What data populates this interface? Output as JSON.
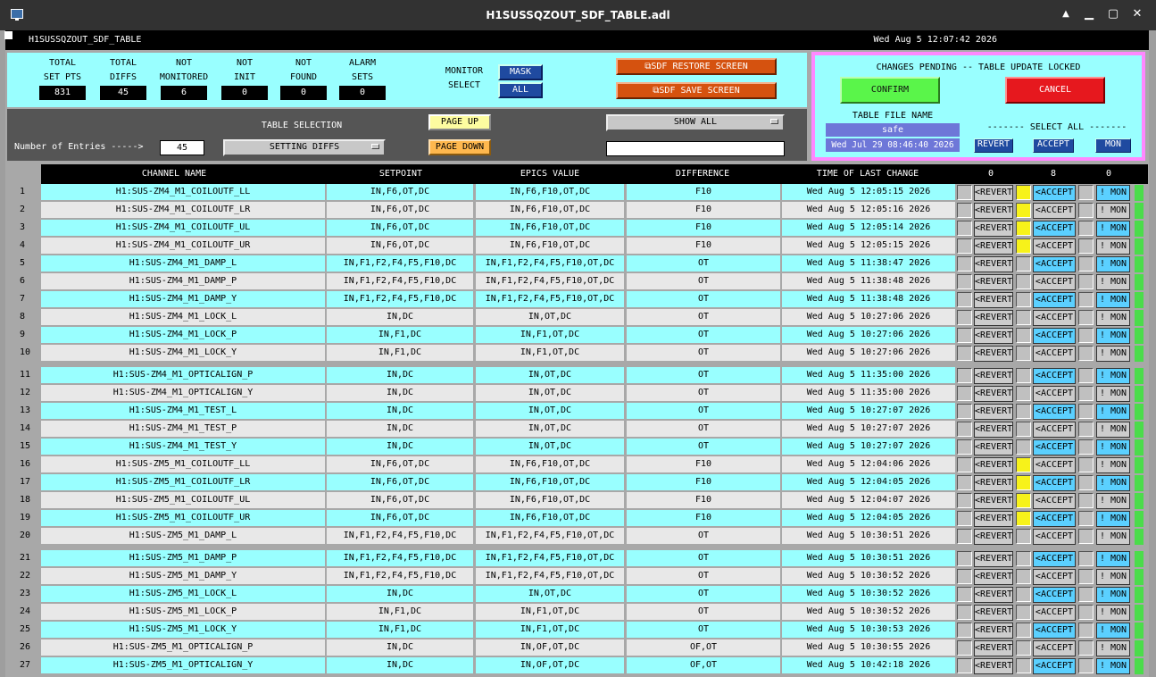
{
  "window": {
    "title": "H1SUSSQZOUT_SDF_TABLE.adl",
    "min": "▁",
    "max": "▢",
    "close": "✕",
    "restore": "▲"
  },
  "header": {
    "name": "H1SUSSQZOUT_SDF_TABLE",
    "datetime": "Wed Aug  5 12:07:42 2026"
  },
  "stats": [
    {
      "label1": "TOTAL",
      "label2": "SET PTS",
      "value": "831"
    },
    {
      "label1": "TOTAL",
      "label2": "DIFFS",
      "value": "45"
    },
    {
      "label1": "NOT",
      "label2": "MONITORED",
      "value": "6"
    },
    {
      "label1": "NOT",
      "label2": "INIT",
      "value": "0"
    },
    {
      "label1": "NOT",
      "label2": "FOUND",
      "value": "0"
    },
    {
      "label1": "ALARM",
      "label2": "SETS",
      "value": "0"
    }
  ],
  "monitor": {
    "label1": "MONITOR",
    "label2": "SELECT",
    "mask": "MASK",
    "all": "ALL"
  },
  "restore_btn": "SDF RESTORE SCREEN",
  "save_btn": "SDF SAVE SCREEN",
  "pending": {
    "title": "CHANGES PENDING -- TABLE UPDATE LOCKED",
    "confirm": "CONFIRM",
    "cancel": "CANCEL",
    "file_label": "TABLE FILE NAME",
    "file": "safe",
    "file_time": "Wed Jul 29 08:46:40 2026",
    "select_all": "------- SELECT ALL -------",
    "revert": "REVERT",
    "accept": "ACCEPT",
    "mon": "MON"
  },
  "table_sel": {
    "label": "TABLE SELECTION",
    "entries_label": "Number of Entries ----->",
    "entries": "45",
    "mode": "SETTING DIFFS",
    "page_up": "PAGE UP",
    "page_down": "PAGE DOWN",
    "show": "SHOW ALL",
    "filter": ""
  },
  "columns": {
    "name": "CHANNEL NAME",
    "setpoint": "SETPOINT",
    "epics": "EPICS VALUE",
    "diff": "DIFFERENCE",
    "time": "TIME OF LAST CHANGE",
    "c1": "0",
    "c2": "8",
    "c3": "0"
  },
  "buttons": {
    "revert": "<REVERT",
    "accept": "<ACCEPT",
    "mon": "! MON"
  },
  "rows": [
    {
      "n": "1",
      "name": "H1:SUS-ZM4_M1_COILOUTF_LL",
      "sp": "IN,F6,OT,DC",
      "ev": "IN,F6,F10,OT,DC",
      "df": "F10",
      "t": "Wed Aug  5 12:05:15 2026",
      "acc": true
    },
    {
      "n": "2",
      "name": "H1:SUS-ZM4_M1_COILOUTF_LR",
      "sp": "IN,F6,OT,DC",
      "ev": "IN,F6,F10,OT,DC",
      "df": "F10",
      "t": "Wed Aug  5 12:05:16 2026",
      "acc": true
    },
    {
      "n": "3",
      "name": "H1:SUS-ZM4_M1_COILOUTF_UL",
      "sp": "IN,F6,OT,DC",
      "ev": "IN,F6,F10,OT,DC",
      "df": "F10",
      "t": "Wed Aug  5 12:05:14 2026",
      "acc": true
    },
    {
      "n": "4",
      "name": "H1:SUS-ZM4_M1_COILOUTF_UR",
      "sp": "IN,F6,OT,DC",
      "ev": "IN,F6,F10,OT,DC",
      "df": "F10",
      "t": "Wed Aug  5 12:05:15 2026",
      "acc": true
    },
    {
      "n": "5",
      "name": "H1:SUS-ZM4_M1_DAMP_L",
      "sp": "IN,F1,F2,F4,F5,F10,DC",
      "ev": "IN,F1,F2,F4,F5,F10,OT,DC",
      "df": "OT",
      "t": "Wed Aug  5 11:38:47 2026",
      "acc": false
    },
    {
      "n": "6",
      "name": "H1:SUS-ZM4_M1_DAMP_P",
      "sp": "IN,F1,F2,F4,F5,F10,DC",
      "ev": "IN,F1,F2,F4,F5,F10,OT,DC",
      "df": "OT",
      "t": "Wed Aug  5 11:38:48 2026",
      "acc": false
    },
    {
      "n": "7",
      "name": "H1:SUS-ZM4_M1_DAMP_Y",
      "sp": "IN,F1,F2,F4,F5,F10,DC",
      "ev": "IN,F1,F2,F4,F5,F10,OT,DC",
      "df": "OT",
      "t": "Wed Aug  5 11:38:48 2026",
      "acc": false
    },
    {
      "n": "8",
      "name": "H1:SUS-ZM4_M1_LOCK_L",
      "sp": "IN,DC",
      "ev": "IN,OT,DC",
      "df": "OT",
      "t": "Wed Aug  5 10:27:06 2026",
      "acc": false
    },
    {
      "n": "9",
      "name": "H1:SUS-ZM4_M1_LOCK_P",
      "sp": "IN,F1,DC",
      "ev": "IN,F1,OT,DC",
      "df": "OT",
      "t": "Wed Aug  5 10:27:06 2026",
      "acc": false
    },
    {
      "n": "10",
      "name": "H1:SUS-ZM4_M1_LOCK_Y",
      "sp": "IN,F1,DC",
      "ev": "IN,F1,OT,DC",
      "df": "OT",
      "t": "Wed Aug  5 10:27:06 2026",
      "acc": false
    },
    {
      "n": "11",
      "name": "H1:SUS-ZM4_M1_OPTICALIGN_P",
      "sp": "IN,DC",
      "ev": "IN,OT,DC",
      "df": "OT",
      "t": "Wed Aug  5 11:35:00 2026",
      "acc": false
    },
    {
      "n": "12",
      "name": "H1:SUS-ZM4_M1_OPTICALIGN_Y",
      "sp": "IN,DC",
      "ev": "IN,OT,DC",
      "df": "OT",
      "t": "Wed Aug  5 11:35:00 2026",
      "acc": false
    },
    {
      "n": "13",
      "name": "H1:SUS-ZM4_M1_TEST_L",
      "sp": "IN,DC",
      "ev": "IN,OT,DC",
      "df": "OT",
      "t": "Wed Aug  5 10:27:07 2026",
      "acc": false
    },
    {
      "n": "14",
      "name": "H1:SUS-ZM4_M1_TEST_P",
      "sp": "IN,DC",
      "ev": "IN,OT,DC",
      "df": "OT",
      "t": "Wed Aug  5 10:27:07 2026",
      "acc": false
    },
    {
      "n": "15",
      "name": "H1:SUS-ZM4_M1_TEST_Y",
      "sp": "IN,DC",
      "ev": "IN,OT,DC",
      "df": "OT",
      "t": "Wed Aug  5 10:27:07 2026",
      "acc": false
    },
    {
      "n": "16",
      "name": "H1:SUS-ZM5_M1_COILOUTF_LL",
      "sp": "IN,F6,OT,DC",
      "ev": "IN,F6,F10,OT,DC",
      "df": "F10",
      "t": "Wed Aug  5 12:04:06 2026",
      "acc": true
    },
    {
      "n": "17",
      "name": "H1:SUS-ZM5_M1_COILOUTF_LR",
      "sp": "IN,F6,OT,DC",
      "ev": "IN,F6,F10,OT,DC",
      "df": "F10",
      "t": "Wed Aug  5 12:04:05 2026",
      "acc": true
    },
    {
      "n": "18",
      "name": "H1:SUS-ZM5_M1_COILOUTF_UL",
      "sp": "IN,F6,OT,DC",
      "ev": "IN,F6,F10,OT,DC",
      "df": "F10",
      "t": "Wed Aug  5 12:04:07 2026",
      "acc": true
    },
    {
      "n": "19",
      "name": "H1:SUS-ZM5_M1_COILOUTF_UR",
      "sp": "IN,F6,OT,DC",
      "ev": "IN,F6,F10,OT,DC",
      "df": "F10",
      "t": "Wed Aug  5 12:04:05 2026",
      "acc": true
    },
    {
      "n": "20",
      "name": "H1:SUS-ZM5_M1_DAMP_L",
      "sp": "IN,F1,F2,F4,F5,F10,DC",
      "ev": "IN,F1,F2,F4,F5,F10,OT,DC",
      "df": "OT",
      "t": "Wed Aug  5 10:30:51 2026",
      "acc": false
    },
    {
      "n": "21",
      "name": "H1:SUS-ZM5_M1_DAMP_P",
      "sp": "IN,F1,F2,F4,F5,F10,DC",
      "ev": "IN,F1,F2,F4,F5,F10,OT,DC",
      "df": "OT",
      "t": "Wed Aug  5 10:30:51 2026",
      "acc": false
    },
    {
      "n": "22",
      "name": "H1:SUS-ZM5_M1_DAMP_Y",
      "sp": "IN,F1,F2,F4,F5,F10,DC",
      "ev": "IN,F1,F2,F4,F5,F10,OT,DC",
      "df": "OT",
      "t": "Wed Aug  5 10:30:52 2026",
      "acc": false
    },
    {
      "n": "23",
      "name": "H1:SUS-ZM5_M1_LOCK_L",
      "sp": "IN,DC",
      "ev": "IN,OT,DC",
      "df": "OT",
      "t": "Wed Aug  5 10:30:52 2026",
      "acc": false
    },
    {
      "n": "24",
      "name": "H1:SUS-ZM5_M1_LOCK_P",
      "sp": "IN,F1,DC",
      "ev": "IN,F1,OT,DC",
      "df": "OT",
      "t": "Wed Aug  5 10:30:52 2026",
      "acc": false
    },
    {
      "n": "25",
      "name": "H1:SUS-ZM5_M1_LOCK_Y",
      "sp": "IN,F1,DC",
      "ev": "IN,F1,OT,DC",
      "df": "OT",
      "t": "Wed Aug  5 10:30:53 2026",
      "acc": false
    },
    {
      "n": "26",
      "name": "H1:SUS-ZM5_M1_OPTICALIGN_P",
      "sp": "IN,DC",
      "ev": "IN,OF,OT,DC",
      "df": "OF,OT",
      "t": "Wed Aug  5 10:30:55 2026",
      "acc": false
    },
    {
      "n": "27",
      "name": "H1:SUS-ZM5_M1_OPTICALIGN_Y",
      "sp": "IN,DC",
      "ev": "IN,OF,OT,DC",
      "df": "OF,OT",
      "t": "Wed Aug  5 10:42:18 2026",
      "acc": false
    }
  ],
  "colors": {
    "cyan": "#99ffff",
    "gray": "#e8e8e8",
    "accent": "#1f4aa0",
    "pink": "#ff88ff"
  }
}
